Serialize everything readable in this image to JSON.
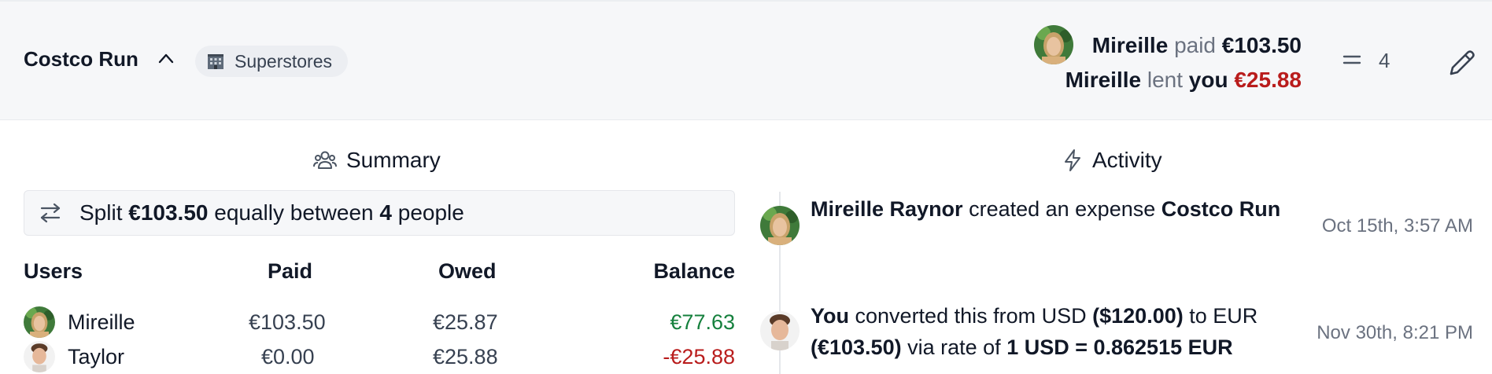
{
  "header": {
    "title": "Costco Run",
    "category": "Superstores",
    "payer_name": "Mireille",
    "paid_word": "paid",
    "paid_amount": "€103.50",
    "lender_name": "Mireille",
    "lent_word": "lent",
    "you_word": "you",
    "lent_amount": "€25.88",
    "participant_count": "4"
  },
  "summary": {
    "heading": "Summary",
    "split_prefix": "Split",
    "split_amount": "€103.50",
    "split_middle": "equally between",
    "split_count": "4",
    "split_suffix": "people",
    "columns": {
      "users": "Users",
      "paid": "Paid",
      "owed": "Owed",
      "balance": "Balance"
    },
    "rows": [
      {
        "name": "Mireille",
        "paid": "€103.50",
        "owed": "€25.87",
        "balance": "€77.63"
      },
      {
        "name": "Taylor",
        "paid": "€0.00",
        "owed": "€25.88",
        "balance": "-€25.88"
      }
    ]
  },
  "activity": {
    "heading": "Activity",
    "items": [
      {
        "actor": "Mireille Raynor",
        "action": "created an expense",
        "target": "Costco Run",
        "time": "Oct 15th, 3:57 AM"
      },
      {
        "actor": "You",
        "p1": "converted this from USD",
        "from_amount": "($120.00)",
        "p2": "to EUR",
        "to_amount": "(€103.50)",
        "p3": "via rate of",
        "rate": "1 USD = 0.862515 EUR",
        "time": "Nov 30th, 8:21 PM"
      }
    ]
  },
  "colors": {
    "positive": "#15803d",
    "negative": "#b91c1c",
    "bar_bg": "#f6f7f9"
  }
}
